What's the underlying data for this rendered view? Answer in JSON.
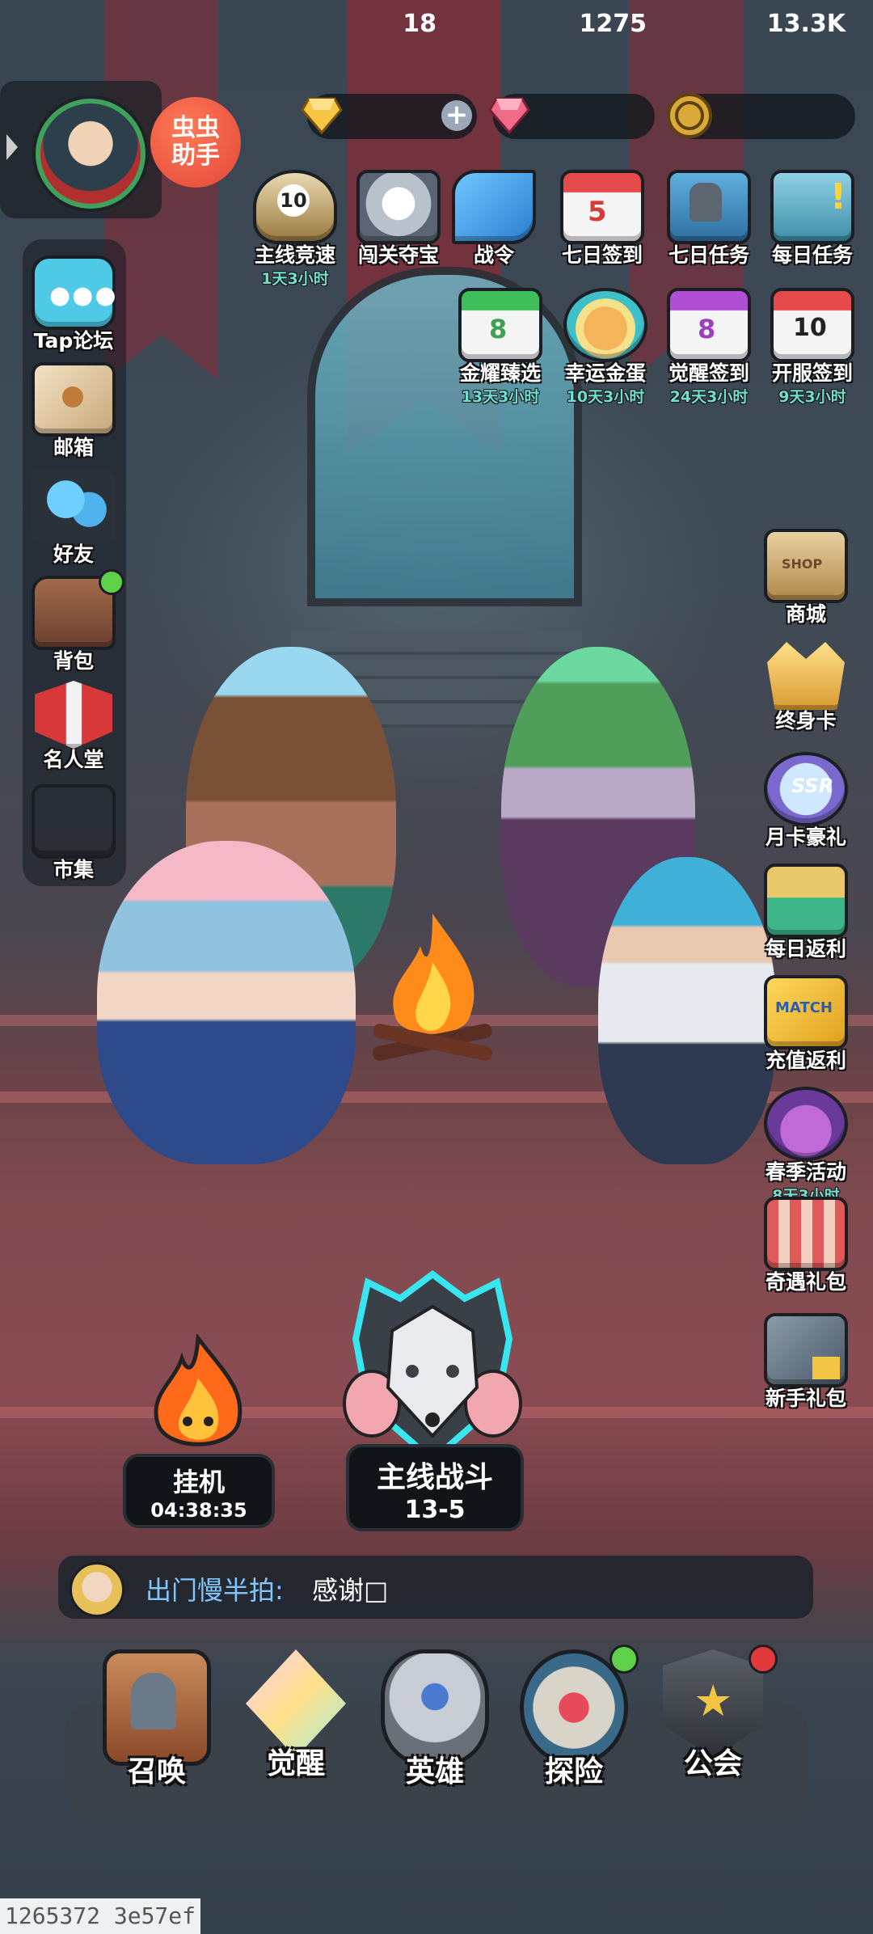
{
  "resources": [
    {
      "icon": "gold-diamond-icon",
      "value": "18",
      "has_add": true
    },
    {
      "icon": "pink-gem-icon",
      "value": "1275"
    },
    {
      "icon": "gold-coin-icon",
      "value": "13.3K"
    }
  ],
  "helper": {
    "label": "虫虫助手"
  },
  "top_events_row1": [
    {
      "name": "主线竞速",
      "badge": "10",
      "timer": "1天3小时"
    },
    {
      "name": "闯关夺宝"
    },
    {
      "name": "战令"
    },
    {
      "name": "七日签到",
      "badge": "5"
    },
    {
      "name": "七日任务"
    },
    {
      "name": "每日任务"
    }
  ],
  "top_events_row2": [
    {
      "name": "金耀臻选",
      "badge": "8",
      "timer": "13天3小时"
    },
    {
      "name": "幸运金蛋",
      "timer": "10天3小时"
    },
    {
      "name": "觉醒签到",
      "badge": "8",
      "timer": "24天3小时"
    },
    {
      "name": "开服签到",
      "badge": "10",
      "timer": "9天3小时"
    }
  ],
  "left_menu": [
    {
      "name": "Tap论坛"
    },
    {
      "name": "邮箱"
    },
    {
      "name": "好友"
    },
    {
      "name": "背包"
    },
    {
      "name": "名人堂"
    },
    {
      "name": "市集"
    }
  ],
  "right_menu": [
    {
      "name": "商城",
      "tag": "SHOP"
    },
    {
      "name": "终身卡"
    },
    {
      "name": "月卡豪礼",
      "tag": "SSR"
    },
    {
      "name": "每日返利"
    },
    {
      "name": "充值返利",
      "tag": "MATCH"
    },
    {
      "name": "春季活动",
      "timer": "8天3小时"
    },
    {
      "name": "奇遇礼包"
    },
    {
      "name": "新手礼包"
    }
  ],
  "idle": {
    "label": "挂机",
    "time": "04:38:35"
  },
  "battle": {
    "label": "主线战斗",
    "stage": "13-5"
  },
  "chat": {
    "name": "出门慢半拍:",
    "message": "感谢□"
  },
  "bottom_nav": [
    {
      "name": "召唤"
    },
    {
      "name": "觉醒"
    },
    {
      "name": "英雄"
    },
    {
      "name": "探险"
    },
    {
      "name": "公会"
    }
  ],
  "watermark": "1265372 3e57ef",
  "colors": {
    "timer": "#6fe0d0",
    "chat_name": "#7ec7ff",
    "badge_green": "#5fd04a",
    "badge_red": "#e23a3a"
  }
}
